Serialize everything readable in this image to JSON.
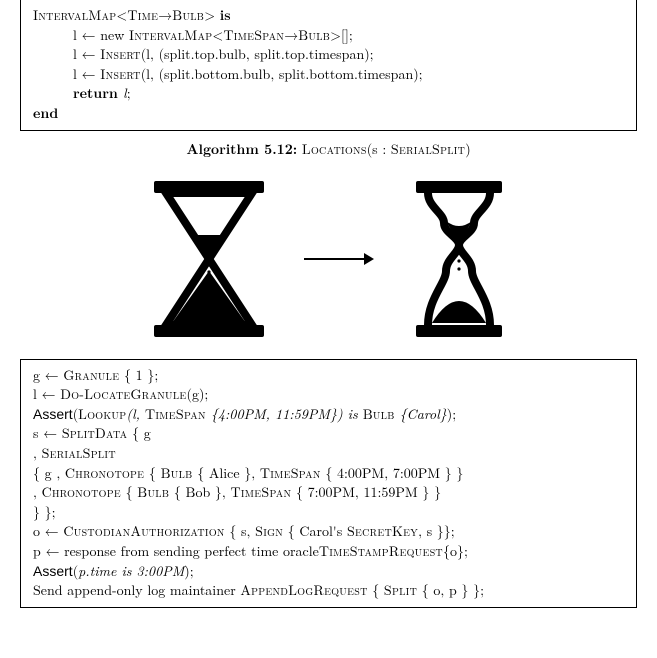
{
  "algo1": {
    "line0": "IntervalMap<Time→Bulb> is",
    "line1": "l ← new IntervalMap<TimeSpan→Bulb>[];",
    "line2": "l ← Insert(l, (split.top.bulb, split.top.timespan);",
    "line3": "l ← Insert(l, (split.bottom.bulb, split.bottom.timespan);",
    "line4": "return l;",
    "line5": "end"
  },
  "caption1": {
    "label": "Algorithm 5.12:",
    "name": "Locations(s : SerialSplit)"
  },
  "algo2": {
    "l1a": "g ← ",
    "l1b": "Granule",
    "l1c": " { 1 };",
    "l2a": "l ← ",
    "l2b": "Do-LocateGranule",
    "l2c": "(g);",
    "l3a": "Assert",
    "l3b": "(",
    "l3c": "Lookup",
    "l3d": "(l, ",
    "l3e": "TimeSpan",
    "l3f": " {4:00PM, 11:59PM}) is ",
    "l3g": "Bulb",
    "l3h": " {Carol}",
    "l3i": ");",
    "l4a": "s ← ",
    "l4b": "SplitData",
    "l4c": " { g",
    "l5a": ", ",
    "l5b": "SerialSplit",
    "l6a": "{ g , ",
    "l6b": "Chronotope",
    "l6c": "   { ",
    "l6d": "Bulb",
    "l6e": "   { Alice }, ",
    "l6f": "TimeSpan",
    "l6g": "   { 4:00PM, 7:00PM } }",
    "l7a": ", ",
    "l7b": "Chronotope",
    "l7c": "   { ",
    "l7d": "Bulb",
    "l7e": "   { Bob }, ",
    "l7f": "TimeSpan",
    "l7g": "   { 7:00PM, 11:59PM } }",
    "l8": "} };",
    "l9a": "o ← ",
    "l9b": "CustodianAuthorization",
    "l9c": "   { s, ",
    "l9d": "Sign",
    "l9e": "   { Carol's ",
    "l9f": "SecretKey",
    "l9g": ", s }};",
    "l10a": "p ← response from sending perfect time oracle",
    "l10b": "TimeStampRequest",
    "l10c": "{o};",
    "l11a": "Assert",
    "l11b": "(",
    "l11c": "p.time is 3:00PM",
    "l11d": ");",
    "l12a": "Send append-only log maintainer ",
    "l12b": "AppendLogRequest",
    "l12c": "   { ",
    "l12d": "Split",
    "l12e": "   { o, p } };"
  }
}
